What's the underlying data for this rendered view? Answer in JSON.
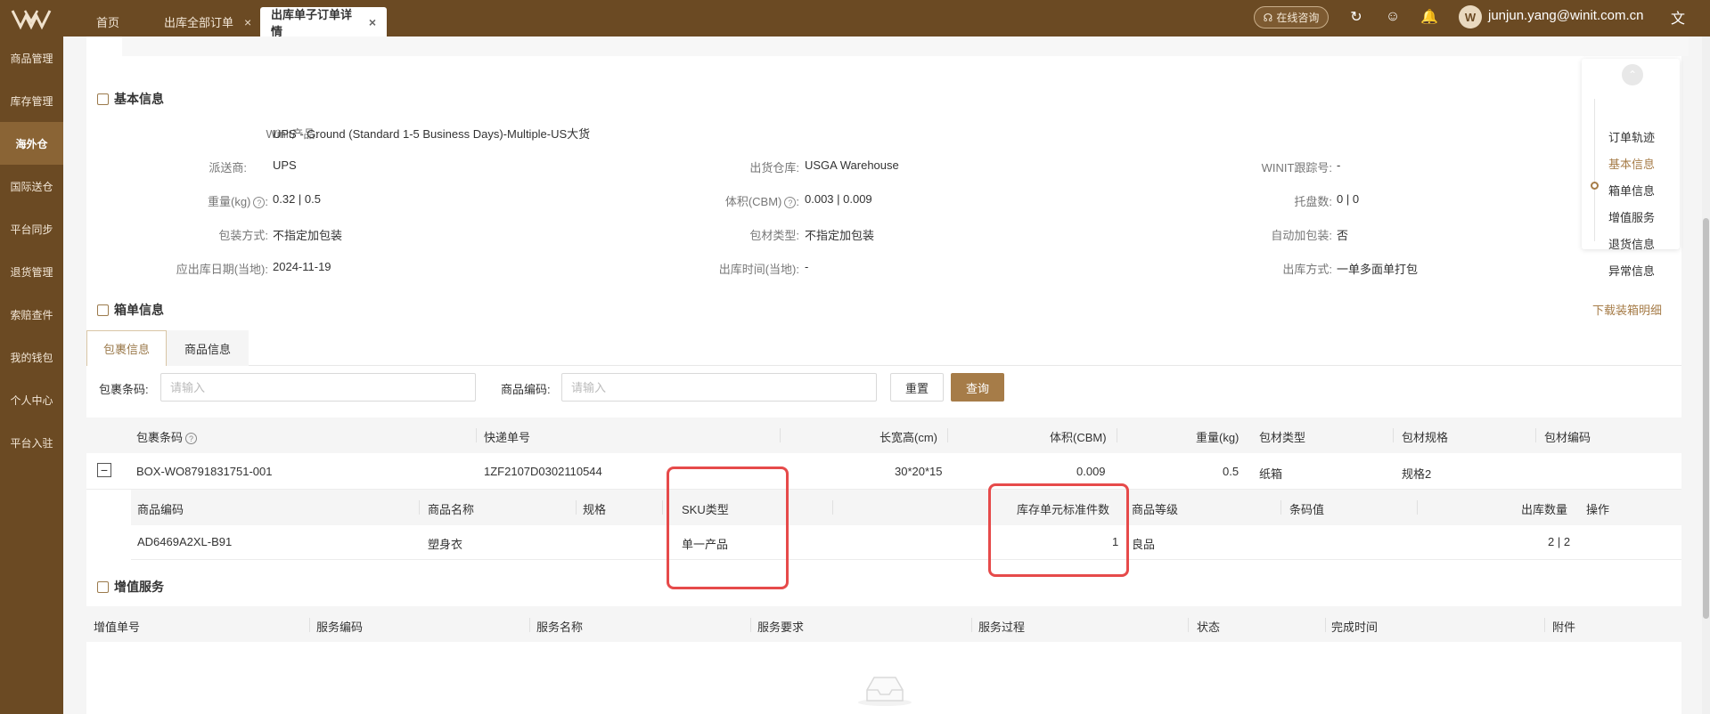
{
  "topbar": {
    "tabs": [
      {
        "label": "首页"
      },
      {
        "label": "出库全部订单"
      },
      {
        "label": "出库单子订单详情"
      }
    ],
    "consult_label": "在线咨询",
    "user_email": "junjun.yang@winit.com.cn"
  },
  "sidebar": {
    "items": [
      {
        "label": "商品管理"
      },
      {
        "label": "库存管理"
      },
      {
        "label": "海外仓"
      },
      {
        "label": "国际送仓"
      },
      {
        "label": "平台同步"
      },
      {
        "label": "退货管理"
      },
      {
        "label": "索赔查件"
      },
      {
        "label": "我的钱包"
      },
      {
        "label": "个人中心"
      },
      {
        "label": "平台入驻"
      }
    ]
  },
  "basic_info": {
    "title": "基本信息",
    "product_label": "Winit产品:",
    "product_value": "UPS - Ground (Standard 1-5 Business Days)-Multiple-US大货",
    "carrier_label": "派送商:",
    "carrier_value": "UPS",
    "warehouse_label": "出货仓库:",
    "warehouse_value": "USGA Warehouse",
    "tracking_label": "WINIT跟踪号:",
    "tracking_value": "-",
    "weight_label": "重量(kg)",
    "weight_value": "0.32 | 0.5",
    "volume_label": "体积(CBM)",
    "volume_value": "0.003 | 0.009",
    "pallet_label": "托盘数:",
    "pallet_value": "0 | 0",
    "packing_label": "包装方式:",
    "packing_value": "不指定加包装",
    "material_label": "包材类型:",
    "material_value": "不指定加包装",
    "auto_pack_label": "自动加包装:",
    "auto_pack_value": "否",
    "due_date_label": "应出库日期(当地):",
    "due_date_value": "2024-11-19",
    "out_time_label": "出库时间(当地):",
    "out_time_value": "-",
    "out_method_label": "出库方式:",
    "out_method_value": "一单多面单打包"
  },
  "box_info": {
    "title": "箱单信息",
    "download_label": "下载装箱明细",
    "tabs": [
      {
        "label": "包裹信息"
      },
      {
        "label": "商品信息"
      }
    ],
    "filter": {
      "package_code_label": "包裹条码:",
      "package_code_placeholder": "请输入",
      "product_code_label": "商品编码:",
      "product_code_placeholder": "请输入",
      "reset_label": "重置",
      "search_label": "查询"
    },
    "columns": {
      "package_code": "包裹条码",
      "express_no": "快递单号",
      "dims": "长宽高(cm)",
      "volume": "体积(CBM)",
      "weight": "重量(kg)",
      "material_type": "包材类型",
      "material_spec": "包材规格",
      "material_code": "包材编码"
    },
    "row": {
      "package_code": "BOX-WO8791831751-001",
      "express_no": "1ZF2107D0302110544",
      "dims": "30*20*15",
      "volume": "0.009",
      "weight": "0.5",
      "material_type": "纸箱",
      "material_spec": "规格2",
      "material_code": ""
    },
    "sub_columns": {
      "product_code": "商品编码",
      "product_name": "商品名称",
      "spec": "规格",
      "sku_type": "SKU类型",
      "std_qty": "库存单元标准件数",
      "grade": "商品等级",
      "barcode": "条码值",
      "out_qty": "出库数量",
      "action": "操作"
    },
    "sub_row": {
      "product_code": "AD6469A2XL-B91",
      "product_name": "塑身衣",
      "spec": "",
      "sku_type": "单一产品",
      "std_qty": "1",
      "grade": "良品",
      "barcode": "",
      "out_qty": "2 | 2",
      "action": ""
    }
  },
  "vas": {
    "title": "增值服务",
    "columns": {
      "vas_no": "增值单号",
      "service_code": "服务编码",
      "service_name": "服务名称",
      "requirement": "服务要求",
      "process": "服务过程",
      "status": "状态",
      "finish_time": "完成时间",
      "attachment": "附件"
    }
  },
  "anchor_nav": {
    "items": [
      {
        "label": "订单轨迹"
      },
      {
        "label": "基本信息"
      },
      {
        "label": "箱单信息"
      },
      {
        "label": "增值服务"
      },
      {
        "label": "退货信息"
      },
      {
        "label": "异常信息"
      }
    ]
  },
  "colors": {
    "brand": "#6b4a23",
    "accent": "#a67c48",
    "highlight": "#e64a4a"
  }
}
